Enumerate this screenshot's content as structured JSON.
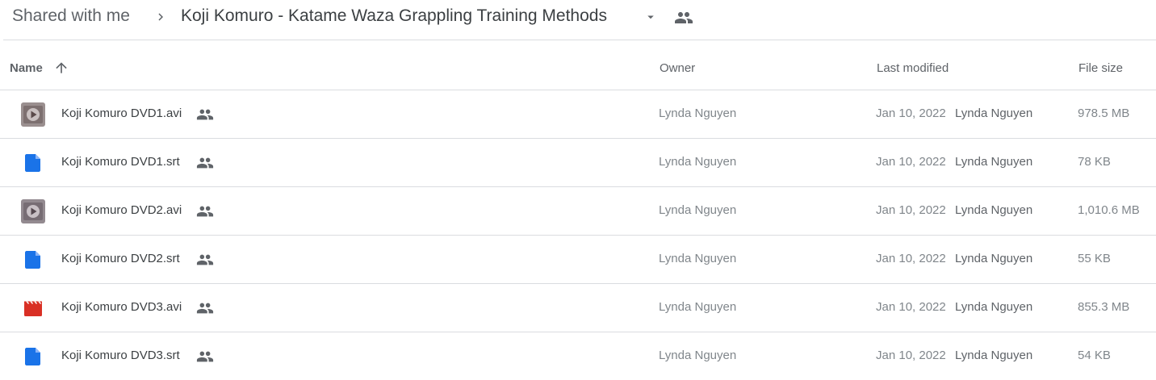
{
  "breadcrumb": {
    "root": "Shared with me",
    "folder": "Koji Komuro - Katame Waza Grappling Training Methods"
  },
  "columns": {
    "name": "Name",
    "owner": "Owner",
    "last_modified": "Last modified",
    "file_size": "File size"
  },
  "files": [
    {
      "name": "Koji Komuro DVD1.avi",
      "icon": "video-thumbnail-icon",
      "owner": "Lynda Nguyen",
      "date": "Jan 10, 2022",
      "modified_by": "Lynda Nguyen",
      "size": "978.5 MB"
    },
    {
      "name": "Koji Komuro DVD1.srt",
      "icon": "doc-icon",
      "owner": "Lynda Nguyen",
      "date": "Jan 10, 2022",
      "modified_by": "Lynda Nguyen",
      "size": "78 KB"
    },
    {
      "name": "Koji Komuro DVD2.avi",
      "icon": "video-thumbnail-icon",
      "owner": "Lynda Nguyen",
      "date": "Jan 10, 2022",
      "modified_by": "Lynda Nguyen",
      "size": "1,010.6 MB"
    },
    {
      "name": "Koji Komuro DVD2.srt",
      "icon": "doc-icon",
      "owner": "Lynda Nguyen",
      "date": "Jan 10, 2022",
      "modified_by": "Lynda Nguyen",
      "size": "55 KB"
    },
    {
      "name": "Koji Komuro DVD3.avi",
      "icon": "video-clapper-icon",
      "owner": "Lynda Nguyen",
      "date": "Jan 10, 2022",
      "modified_by": "Lynda Nguyen",
      "size": "855.3 MB"
    },
    {
      "name": "Koji Komuro DVD3.srt",
      "icon": "doc-icon",
      "owner": "Lynda Nguyen",
      "date": "Jan 10, 2022",
      "modified_by": "Lynda Nguyen",
      "size": "54 KB"
    }
  ],
  "colors": {
    "doc_blue": "#1a73e8",
    "video_red": "#d93025",
    "divider": "#dadce0"
  }
}
